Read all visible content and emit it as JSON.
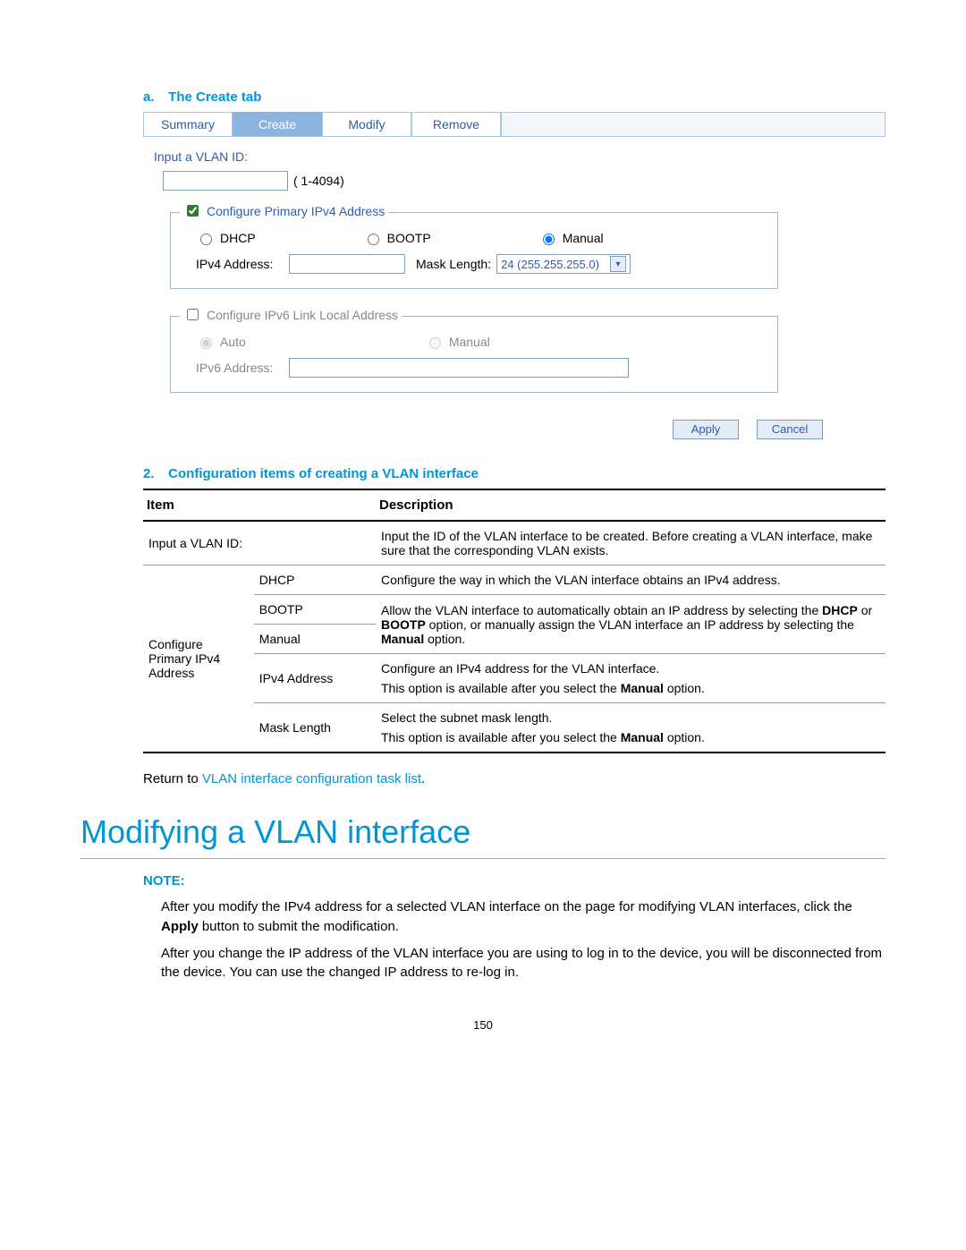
{
  "headings": {
    "a_marker": "a.",
    "a_title": "The Create tab",
    "two_marker": "2.",
    "two_title": "Configuration items of creating a VLAN interface"
  },
  "tabs": {
    "summary": "Summary",
    "create": "Create",
    "modify": "Modify",
    "remove": "Remove"
  },
  "vlan_form": {
    "prompt": "Input a VLAN ID:",
    "range": "( 1-4094)",
    "ipv4_legend": "Configure Primary IPv4 Address",
    "dhcp": "DHCP",
    "bootp": "BOOTP",
    "manual": "Manual",
    "ipv4_addr_label": "IPv4 Address:",
    "mask_length_label": "Mask Length:",
    "mask_length_value": "24 (255.255.255.0)",
    "ipv6_legend": "Configure IPv6 Link Local Address",
    "auto": "Auto",
    "ipv6_addr_label": "IPv6 Address:"
  },
  "buttons": {
    "apply": "Apply",
    "cancel": "Cancel"
  },
  "table": {
    "head_item": "Item",
    "head_desc": "Description",
    "rows": {
      "r1_item": "Input a VLAN ID:",
      "r1_desc": "Input the ID of the VLAN interface to be created. Before creating a VLAN interface, make sure that the corresponding VLAN exists.",
      "r2_group": "Configure Primary IPv4 Address",
      "r2_dhcp": "DHCP",
      "r2_dhcp_desc": "Configure the way in which the VLAN interface obtains an IPv4 address.",
      "r2_bootp": "BOOTP",
      "r2_manual": "Manual",
      "r2_bootp_desc_a": "Allow the VLAN interface to automatically obtain an IP address by selecting the ",
      "r2_bootp_desc_b": " or ",
      "r2_bootp_desc_c": " option, or manually assign the VLAN interface an IP address by selecting the ",
      "r2_bootp_desc_d": " option.",
      "r2_ipv4addr": "IPv4 Address",
      "r2_ipv4addr_desc_a": "Configure an IPv4 address for the VLAN interface.",
      "r2_ipv4addr_desc_b": "This option is available after you select the ",
      "r2_mask": "Mask Length",
      "r2_mask_desc_a": "Select the subnet mask length.",
      "dhcp_b": "DHCP",
      "bootp_b": "BOOTP",
      "manual_b": "Manual",
      "option_word": " option."
    }
  },
  "return": {
    "prefix": "Return to ",
    "link_text": "VLAN interface configuration task list",
    "suffix": "."
  },
  "section_title": "Modifying a VLAN interface",
  "note": {
    "head": "NOTE:",
    "p1_a": "After you modify the IPv4 address for a selected VLAN interface on the page for modifying VLAN interfaces, click the ",
    "p1_b": "Apply",
    "p1_c": " button to submit the modification.",
    "p2": "After you change the IP address of the VLAN interface you are using to log in to the device, you will be disconnected from the device. You can use the changed IP address to re-log in."
  },
  "page_number": "150"
}
